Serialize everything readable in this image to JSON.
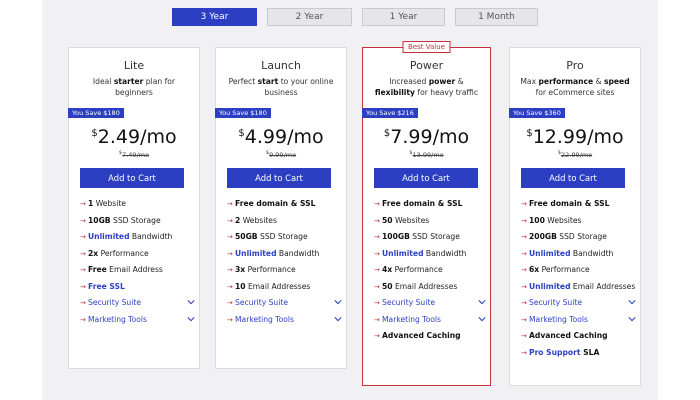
{
  "term_tabs": [
    {
      "label": "3 Year",
      "active": true
    },
    {
      "label": "2 Year",
      "active": false
    },
    {
      "label": "1 Year",
      "active": false
    },
    {
      "label": "1 Month",
      "active": false
    }
  ],
  "colors": {
    "accent": "#2c3fc2",
    "highlight": "#c4303b"
  },
  "plans": [
    {
      "name": "Lite",
      "tagline": [
        {
          "t": "Ideal "
        },
        {
          "t": "starter",
          "b": true
        },
        {
          "t": " plan for beginners"
        }
      ],
      "save": "You Save $180",
      "currency": "$",
      "price": "2.49/mo",
      "old_currency": "$",
      "old_price": "7.49/mo",
      "cta": "Add to Cart",
      "features": [
        {
          "parts": [
            {
              "t": "1",
              "b": true
            },
            {
              "t": " Website"
            }
          ]
        },
        {
          "parts": [
            {
              "t": "10GB",
              "b": true
            },
            {
              "t": " SSD Storage"
            }
          ]
        },
        {
          "parts": [
            {
              "t": "Unlimited",
              "blue": true
            },
            {
              "t": " Bandwidth"
            }
          ]
        },
        {
          "parts": [
            {
              "t": "2x",
              "b": true
            },
            {
              "t": " Performance"
            }
          ]
        },
        {
          "parts": [
            {
              "t": "Free",
              "b": true
            },
            {
              "t": " Email Address"
            }
          ]
        },
        {
          "parts": [
            {
              "t": "Free SSL",
              "blue": true
            }
          ]
        },
        {
          "expand": true,
          "parts": [
            {
              "t": "Security Suite"
            }
          ]
        },
        {
          "expand": true,
          "parts": [
            {
              "t": "Marketing Tools"
            }
          ]
        }
      ]
    },
    {
      "name": "Launch",
      "tagline": [
        {
          "t": "Perfect "
        },
        {
          "t": "start",
          "b": true
        },
        {
          "t": " to your online business"
        }
      ],
      "save": "You Save $180",
      "currency": "$",
      "price": "4.99/mo",
      "old_currency": "$",
      "old_price": "9.99/mo",
      "cta": "Add to Cart",
      "features": [
        {
          "parts": [
            {
              "t": "Free domain & SSL",
              "b": true
            }
          ]
        },
        {
          "parts": [
            {
              "t": "2",
              "b": true
            },
            {
              "t": " Websites"
            }
          ]
        },
        {
          "parts": [
            {
              "t": "50GB",
              "b": true
            },
            {
              "t": " SSD Storage"
            }
          ]
        },
        {
          "parts": [
            {
              "t": "Unlimited",
              "blue": true
            },
            {
              "t": " Bandwidth"
            }
          ]
        },
        {
          "parts": [
            {
              "t": "3x",
              "b": true
            },
            {
              "t": " Performance"
            }
          ]
        },
        {
          "parts": [
            {
              "t": "10",
              "b": true
            },
            {
              "t": " Email Addresses"
            }
          ]
        },
        {
          "expand": true,
          "parts": [
            {
              "t": "Security Suite"
            }
          ]
        },
        {
          "expand": true,
          "parts": [
            {
              "t": "Marketing Tools"
            }
          ]
        }
      ]
    },
    {
      "name": "Power",
      "badge": "Best Value",
      "tagline": [
        {
          "t": "Increased "
        },
        {
          "t": "power",
          "b": true
        },
        {
          "t": " & "
        },
        {
          "t": "flexibility",
          "b": true
        },
        {
          "t": " for heavy traffic"
        }
      ],
      "save": "You Save $216",
      "currency": "$",
      "price": "7.99/mo",
      "old_currency": "$",
      "old_price": "13.99/mo",
      "cta": "Add to Cart",
      "features": [
        {
          "parts": [
            {
              "t": "Free domain & SSL",
              "b": true
            }
          ]
        },
        {
          "parts": [
            {
              "t": "50",
              "b": true
            },
            {
              "t": " Websites"
            }
          ]
        },
        {
          "parts": [
            {
              "t": "100GB",
              "b": true
            },
            {
              "t": " SSD Storage"
            }
          ]
        },
        {
          "parts": [
            {
              "t": "Unlimited",
              "blue": true
            },
            {
              "t": " Bandwidth"
            }
          ]
        },
        {
          "parts": [
            {
              "t": "4x",
              "b": true
            },
            {
              "t": " Performance"
            }
          ]
        },
        {
          "parts": [
            {
              "t": "50",
              "b": true
            },
            {
              "t": " Email Addresses"
            }
          ]
        },
        {
          "expand": true,
          "parts": [
            {
              "t": "Security Suite"
            }
          ]
        },
        {
          "expand": true,
          "parts": [
            {
              "t": "Marketing Tools"
            }
          ]
        },
        {
          "parts": [
            {
              "t": "Advanced Caching",
              "b": true
            }
          ]
        }
      ]
    },
    {
      "name": "Pro",
      "tagline": [
        {
          "t": "Max "
        },
        {
          "t": "performance",
          "b": true
        },
        {
          "t": " & "
        },
        {
          "t": "speed",
          "b": true
        },
        {
          "t": " for eCommerce sites"
        }
      ],
      "save": "You Save $360",
      "currency": "$",
      "price": "12.99/mo",
      "old_currency": "$",
      "old_price": "22.99/mo",
      "cta": "Add to Cart",
      "features": [
        {
          "parts": [
            {
              "t": "Free domain & SSL",
              "b": true
            }
          ]
        },
        {
          "parts": [
            {
              "t": "100",
              "b": true
            },
            {
              "t": " Websites"
            }
          ]
        },
        {
          "parts": [
            {
              "t": "200GB",
              "b": true
            },
            {
              "t": " SSD Storage"
            }
          ]
        },
        {
          "parts": [
            {
              "t": "Unlimited",
              "blue": true
            },
            {
              "t": " Bandwidth"
            }
          ]
        },
        {
          "parts": [
            {
              "t": "6x",
              "b": true
            },
            {
              "t": " Performance"
            }
          ]
        },
        {
          "parts": [
            {
              "t": "Unlimited",
              "blue": true
            },
            {
              "t": " Email Addresses"
            }
          ]
        },
        {
          "expand": true,
          "parts": [
            {
              "t": "Security Suite"
            }
          ]
        },
        {
          "expand": true,
          "parts": [
            {
              "t": "Marketing Tools"
            }
          ]
        },
        {
          "parts": [
            {
              "t": "Advanced Caching",
              "b": true
            }
          ]
        },
        {
          "parts": [
            {
              "t": "Pro Support",
              "blue": true
            },
            {
              "t": " SLA",
              "b": true
            }
          ]
        }
      ]
    }
  ]
}
